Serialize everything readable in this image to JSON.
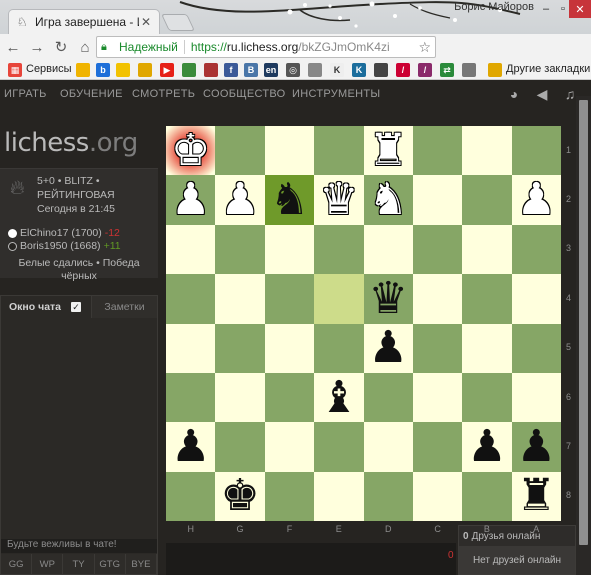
{
  "browser": {
    "tab_title": "Игра завершена - Игра",
    "user_name": "Борис Майоров",
    "secure_label": "Надежный",
    "url_proto": "https://",
    "url_host": "ru.lichess.org",
    "url_path": "/bkZGJmOmK4zi",
    "bookmarks_services": "Сервисы",
    "bookmarks_other": "Другие закладки"
  },
  "site": {
    "nav": [
      "ИГРАТЬ",
      "ОБУЧЕНИЕ",
      "СМОТРЕТЬ",
      "СООБЩЕСТВО",
      "ИНСТРУМЕНТЫ"
    ],
    "logo_main": "lichess",
    "logo_tld": ".org"
  },
  "game": {
    "mode_line": "5+0 • BLITZ •",
    "rating_line": "РЕЙТИНГОВАЯ",
    "date_line": "Сегодня в 21:45",
    "white_player": "ElChino17 (1700)",
    "white_delta": "-12",
    "black_player": "Boris1950 (1668)",
    "black_delta": "+11",
    "result_line1": "Белые сдались • Победа",
    "result_line2": "чёрных"
  },
  "chat": {
    "tab_chat": "Окно чата",
    "tab_notes": "Заметки",
    "placeholder": "Будьте вежливы в чате!",
    "presets": [
      "GG",
      "WP",
      "TY",
      "GTG",
      "BYE"
    ]
  },
  "board": {
    "ranks": [
      "1",
      "2",
      "3",
      "4",
      "5",
      "6",
      "7",
      "8"
    ],
    "files": [
      "H",
      "G",
      "F",
      "E",
      "D",
      "C",
      "B",
      "A"
    ],
    "orientation": "black",
    "highlight_colors": {
      "check": "#e23a2a",
      "last_move": "#cddc8a",
      "selected": "#6f9a2a"
    },
    "pieces": [
      {
        "sq": "h1",
        "symbol": "♚",
        "color": "w",
        "check": true
      },
      {
        "sq": "d1",
        "symbol": "♜",
        "color": "w"
      },
      {
        "sq": "h2",
        "symbol": "♟",
        "color": "w"
      },
      {
        "sq": "g2",
        "symbol": "♟",
        "color": "w"
      },
      {
        "sq": "f2",
        "symbol": "♞",
        "color": "b",
        "selected": true
      },
      {
        "sq": "e2",
        "symbol": "♛",
        "color": "w"
      },
      {
        "sq": "d2",
        "symbol": "♞",
        "color": "w"
      },
      {
        "sq": "a2",
        "symbol": "♟",
        "color": "w"
      },
      {
        "sq": "d4",
        "symbol": "♛",
        "color": "b"
      },
      {
        "sq": "d5",
        "symbol": "♟",
        "color": "b"
      },
      {
        "sq": "e6",
        "symbol": "♝",
        "color": "b"
      },
      {
        "sq": "h7",
        "symbol": "♟",
        "color": "b"
      },
      {
        "sq": "b7",
        "symbol": "♟",
        "color": "b"
      },
      {
        "sq": "a7",
        "symbol": "♟",
        "color": "b"
      },
      {
        "sq": "g8",
        "symbol": "♚",
        "color": "b"
      },
      {
        "sq": "a8",
        "symbol": "♜",
        "color": "b"
      }
    ],
    "last_move_squares": [
      "e4"
    ]
  },
  "friends": {
    "count": "0",
    "label": "Друзья онлайн",
    "none": "Нет друзей онлайн",
    "badge": "0"
  }
}
